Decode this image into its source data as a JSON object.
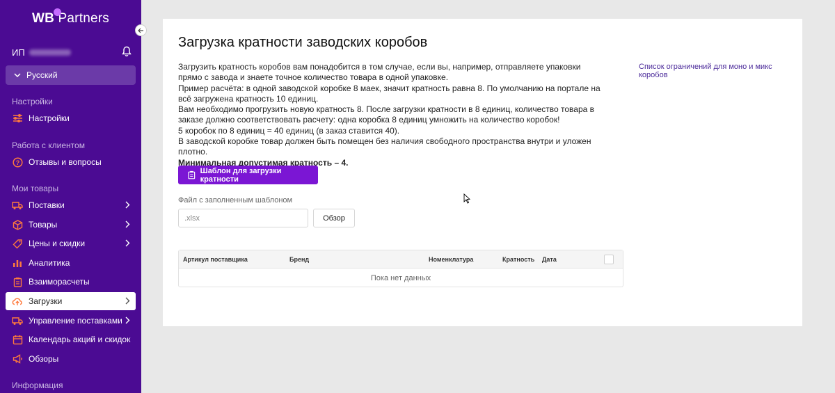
{
  "sidebar": {
    "logo_wb": "WB",
    "logo_partners": "Partners",
    "user_prefix": "ИП",
    "language": "Русский",
    "sections": {
      "settings": "Настройки",
      "clients": "Работа с клиентом",
      "products": "Мои товары",
      "info": "Информация"
    },
    "items": {
      "settings": "Настройки",
      "reviews": "Отзывы и вопросы",
      "supplies": "Поставки",
      "goods": "Товары",
      "prices": "Цены и скидки",
      "analytics": "Аналитика",
      "settlements": "Взаиморасчеты",
      "uploads": "Загрузки",
      "supply_mgmt": "Управление поставками",
      "calendar": "Календарь акций и скидок",
      "reviews2": "Обзоры"
    }
  },
  "main": {
    "title": "Загрузка кратности заводских коробов",
    "description": [
      "Загрузить кратность коробов вам понадобится в том случае, если вы, например, отправляете упаковки прямо с завода и знаете точное количество товара в одной упаковке.",
      "Пример расчёта: в одной заводской коробке 8 маек, значит кратность равна 8. По умолчанию на портале на всё загружена кратность 10 единиц.",
      "Вам необходимо прогрузить новую кратность 8. После загрузки кратности в 8 единиц, количество товара в заказе должно соответствовать расчету: одна коробка 8 единиц умножить на количество коробок!",
      "5 коробок по 8 единиц = 40 единиц (в заказ ставится 40).",
      "В заводской коробке товар должен быть помещен без наличия свободного пространства внутри и уложен плотно."
    ],
    "min_note": "Минимальная допустимая кратность – 4.",
    "limits_link": "Список ограничений для моно и микс коробов",
    "template_button": "Шаблон для загрузки кратности",
    "file_label": "Файл с заполненным шаблоном",
    "file_placeholder": ".xlsx",
    "browse_button": "Обзор",
    "table": {
      "columns": [
        "Артикул поставщика",
        "Бренд",
        "Номенклатура",
        "Кратность",
        "Дата"
      ],
      "empty_text": "Пока нет данных"
    }
  },
  "colors": {
    "sidebar_bg": "#4b0b93",
    "accent": "#7b16d4",
    "link": "#4b2a9a"
  }
}
